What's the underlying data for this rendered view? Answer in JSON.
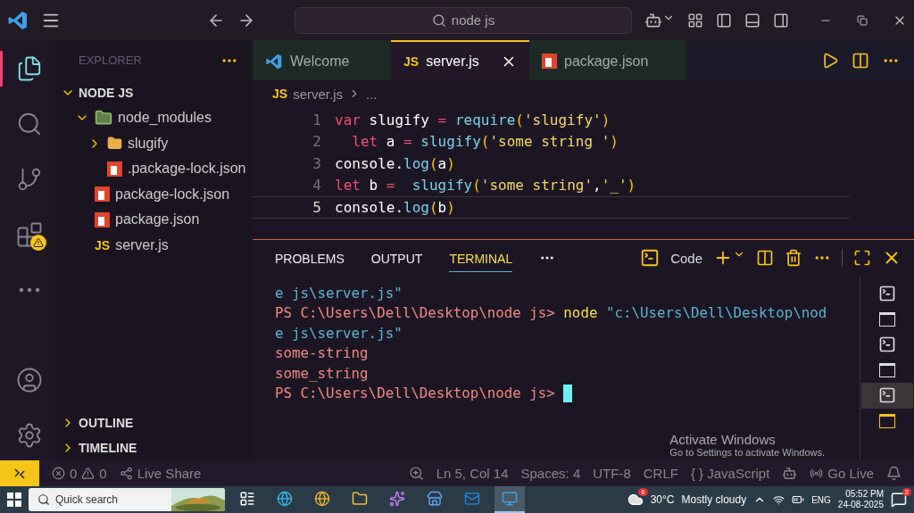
{
  "title_bar": {
    "search": "node js"
  },
  "activity_bar": [
    {
      "kind": "explorer",
      "selected": true
    },
    {
      "kind": "search",
      "selected": false
    },
    {
      "kind": "source-control",
      "selected": false
    },
    {
      "kind": "extensions",
      "selected": false,
      "warning": true
    },
    {
      "kind": "more",
      "selected": false
    }
  ],
  "sidebar": {
    "title": "EXPLORER",
    "sections": [
      {
        "label": "NODE JS",
        "expanded": true,
        "items": [
          {
            "kind": "modules",
            "name": "node_modules",
            "expanded": true,
            "children": [
              {
                "kind": "folder",
                "name": "slugify",
                "expanded": false
              },
              {
                "kind": "npm",
                "name": ".package-lock.json"
              }
            ]
          },
          {
            "kind": "npm",
            "name": "package-lock.json"
          },
          {
            "kind": "npm",
            "name": "package.json"
          },
          {
            "kind": "js",
            "name": "server.js",
            "badge": "JS"
          }
        ]
      }
    ],
    "collapsed_sections": [
      {
        "label": "OUTLINE",
        "expanded": false
      },
      {
        "label": "TIMELINE",
        "expanded": false
      }
    ]
  },
  "tabs": [
    {
      "kind": "welcome",
      "label": "Welcome",
      "selected": false
    },
    {
      "kind": "js",
      "label": "server.js",
      "selected": true,
      "badge": "JS"
    },
    {
      "kind": "npm",
      "label": "package.json",
      "selected": false
    }
  ],
  "breadcrumb": {
    "badge": "JS",
    "file": "server.js",
    "rest": "..."
  },
  "code": [
    {
      "number": "1",
      "current": false,
      "tokens": [
        {
          "kind": "keyword",
          "text": "var"
        },
        {
          "kind": "plain",
          "text": " slugify "
        },
        {
          "kind": "keyword",
          "text": "="
        },
        {
          "kind": "function",
          "text": " require"
        },
        {
          "kind": "paren",
          "text": "("
        },
        {
          "kind": "string",
          "text": "'slugify'"
        },
        {
          "kind": "paren",
          "text": ")"
        }
      ]
    },
    {
      "number": "2",
      "current": false,
      "tokens": [
        {
          "kind": "keyword",
          "text": "  let"
        },
        {
          "kind": "plain",
          "text": " a "
        },
        {
          "kind": "keyword",
          "text": "="
        },
        {
          "kind": "function",
          "text": " slugify"
        },
        {
          "kind": "paren",
          "text": "("
        },
        {
          "kind": "string",
          "text": "'some string '"
        },
        {
          "kind": "paren",
          "text": ")"
        }
      ]
    },
    {
      "number": "3",
      "current": false,
      "tokens": [
        {
          "kind": "plain",
          "text": "console."
        },
        {
          "kind": "function",
          "text": "log"
        },
        {
          "kind": "paren",
          "text": "("
        },
        {
          "kind": "plain",
          "text": "a"
        },
        {
          "kind": "paren",
          "text": ")"
        }
      ]
    },
    {
      "number": "4",
      "current": false,
      "tokens": [
        {
          "kind": "keyword",
          "text": "let"
        },
        {
          "kind": "plain",
          "text": " b "
        },
        {
          "kind": "keyword",
          "text": "="
        },
        {
          "kind": "function",
          "text": "  slugify"
        },
        {
          "kind": "paren",
          "text": "("
        },
        {
          "kind": "string",
          "text": "'some string'"
        },
        {
          "kind": "plain",
          "text": ","
        },
        {
          "kind": "string",
          "text": "'_'"
        },
        {
          "kind": "paren",
          "text": ")"
        }
      ]
    },
    {
      "number": "5",
      "current": true,
      "tokens": [
        {
          "kind": "plain",
          "text": "console."
        },
        {
          "kind": "function",
          "text": "log"
        },
        {
          "kind": "paren",
          "text": "("
        },
        {
          "kind": "plain",
          "text": "b"
        },
        {
          "kind": "paren",
          "text": ")"
        }
      ]
    }
  ],
  "panel": {
    "tabs": [
      {
        "label": "PROBLEMS",
        "selected": false
      },
      {
        "label": "OUTPUT",
        "selected": false
      },
      {
        "label": "TERMINAL",
        "selected": true
      }
    ],
    "terminal_label": "Code",
    "terminal": [
      [
        {
          "kind": "path",
          "text": "e js\\server.js\""
        }
      ],
      [
        {
          "kind": "prompt",
          "text": "PS C:\\Users\\Dell\\Desktop\\node js> "
        },
        {
          "kind": "command",
          "text": "node"
        },
        {
          "kind": "path",
          "text": " \"c:\\Users\\Dell\\Desktop\\nod"
        }
      ],
      [
        {
          "kind": "path",
          "text": "e js\\server.js\""
        }
      ],
      [
        {
          "kind": "output",
          "text": "some-string"
        }
      ],
      [
        {
          "kind": "output",
          "text": "some_string"
        }
      ],
      [
        {
          "kind": "prompt",
          "text": "PS C:\\Users\\Dell\\Desktop\\node js> "
        }
      ]
    ],
    "cursor": true,
    "terminals": [
      {
        "kind": "pwsh",
        "selected": false
      },
      {
        "kind": "cmd",
        "selected": false
      },
      {
        "kind": "pwsh",
        "selected": false
      },
      {
        "kind": "cmd",
        "selected": false
      },
      {
        "kind": "pwsh",
        "selected": true
      },
      {
        "kind": "cmd",
        "selected": false,
        "focused": true
      }
    ]
  },
  "status_bar": {
    "errors": "0",
    "warnings": "0",
    "live_share": "Live Share",
    "position": "Ln 5, Col 14",
    "spaces": "Spaces: 4",
    "encoding": "UTF-8",
    "eol": "CRLF",
    "braces": "{ }",
    "language": "JavaScript",
    "go_live": "Go Live"
  },
  "watermark": {
    "title": "Activate Windows",
    "text": "Go to Settings to activate Windows."
  },
  "taskbar": {
    "search": "Quick search",
    "apps": [
      {
        "kind": "taskview",
        "selected": false
      },
      {
        "kind": "edge",
        "selected": false
      },
      {
        "kind": "chrome",
        "selected": false
      },
      {
        "kind": "files",
        "selected": false
      },
      {
        "kind": "copilot",
        "selected": false
      },
      {
        "kind": "store",
        "selected": false
      },
      {
        "kind": "outlook",
        "selected": false
      },
      {
        "kind": "vscode",
        "selected": true
      }
    ],
    "weather_badge": "6",
    "temperature": "30°C",
    "weather": "Mostly cloudy",
    "language": "ENG",
    "time": "05:52 PM",
    "date": "24-08-2025",
    "notifications": "2"
  }
}
